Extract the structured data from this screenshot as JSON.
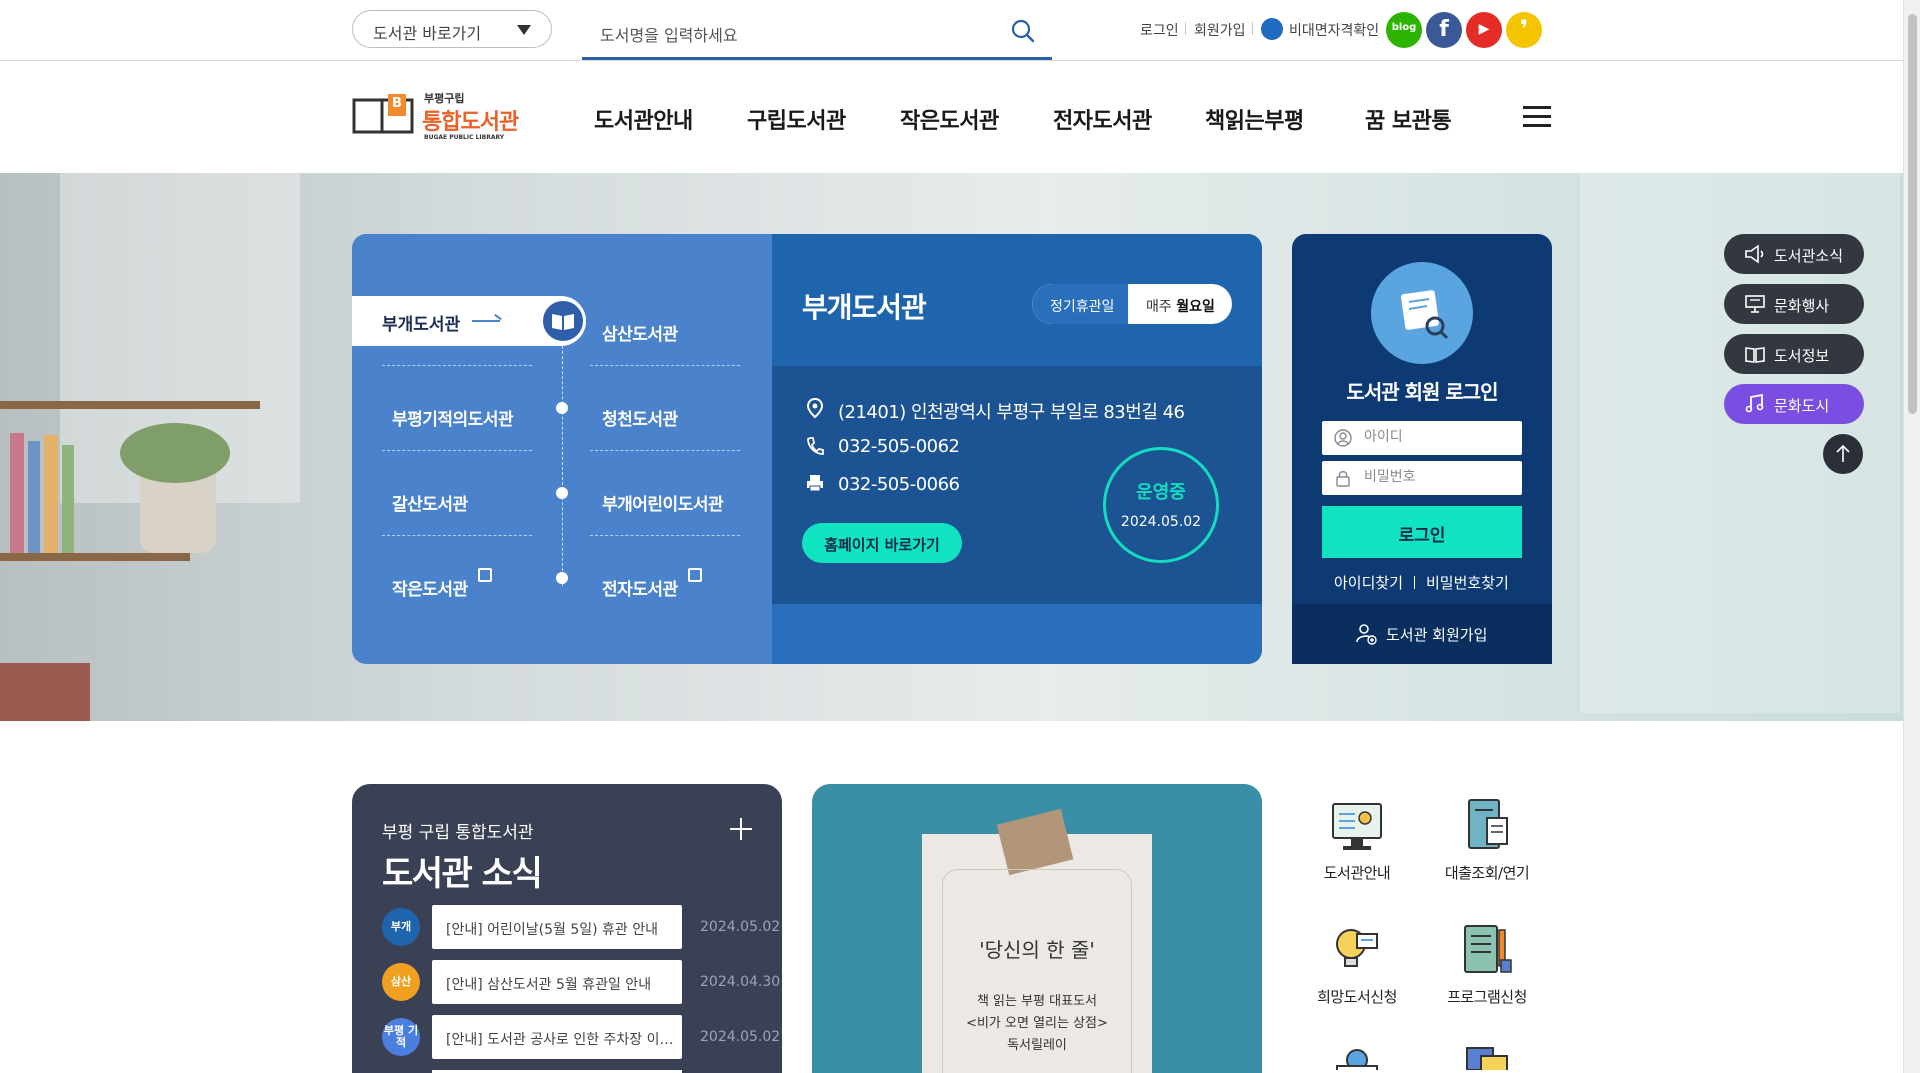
{
  "topbar": {
    "lib_select_label": "도서관 바로가기",
    "search_placeholder": "도서명을 입력하세요",
    "util_links": [
      "로그인",
      "회원가입",
      "비대면자격확인"
    ],
    "sns": [
      {
        "name": "blog",
        "label": "blog",
        "color": "#2db400"
      },
      {
        "name": "facebook",
        "label": "f",
        "color": "#3b5998"
      },
      {
        "name": "youtube",
        "label": "▶",
        "color": "#e52d27"
      },
      {
        "name": "kakao-story",
        "label": "❜",
        "color": "#f5c400"
      }
    ]
  },
  "logo": {
    "top": "부평구립",
    "main": "통합도서관",
    "sub": "BUGAE PUBLIC LIBRARY",
    "badge": "B"
  },
  "nav": [
    "도서관안내",
    "구립도서관",
    "작은도서관",
    "전자도서관",
    "책읽는부평",
    "꿈 보관통"
  ],
  "libraries": {
    "active": "부개도서관",
    "left": [
      "부평기적의도서관",
      "갈산도서관",
      "작은도서관"
    ],
    "right": [
      "삼산도서관",
      "청천도서관",
      "부개어린이도서관",
      "전자도서관"
    ]
  },
  "info": {
    "title": "부개도서관",
    "closed_label": "정기휴관일",
    "closed_prefix": "매주",
    "closed_day": "월요일",
    "address": "(21401) 인천광역시 부평구 부일로 83번길 46",
    "phone": "032-505-0062",
    "fax": "032-505-0066",
    "homepage_button": "홈페이지 바로가기",
    "status": "운영중",
    "status_date": "2024.05.02"
  },
  "login": {
    "title": "도서관 회원 로그인",
    "id_placeholder": "아이디",
    "pw_placeholder": "비밀번호",
    "button": "로그인",
    "find_id": "아이디찾기",
    "find_pw": "비밀번호찾기",
    "join": "도서관 회원가입"
  },
  "quick_menu": [
    "도서관소식",
    "문화행사",
    "도서정보",
    "문화도시"
  ],
  "news": {
    "subtitle": "부평 구립 통합도서관",
    "title": "도서관 소식",
    "items": [
      {
        "badge": "부개",
        "badge_color": "#1e65ad",
        "text": "[안내] 어린이날(5월 5일) 휴관 안내",
        "date": "2024.05.02"
      },
      {
        "badge": "삼산",
        "badge_color": "#f0a020",
        "text": "[안내] 삼산도서관 5월 휴관일 안내",
        "date": "2024.04.30"
      },
      {
        "badge": "부평 기적",
        "badge_color": "#4a7fe0",
        "text": "[안내] 도서관 공사로 인한 주차장 이용 안내",
        "date": "2024.05.02"
      }
    ]
  },
  "banner": {
    "quote": "'당신의 한 줄'",
    "lines": [
      "책 읽는 부평 대표도서",
      "<비가 오면 열리는 상점>",
      "독서릴레이"
    ]
  },
  "services": [
    "도서관안내",
    "대출조회/연기",
    "희망도서신청",
    "프로그램신청"
  ]
}
